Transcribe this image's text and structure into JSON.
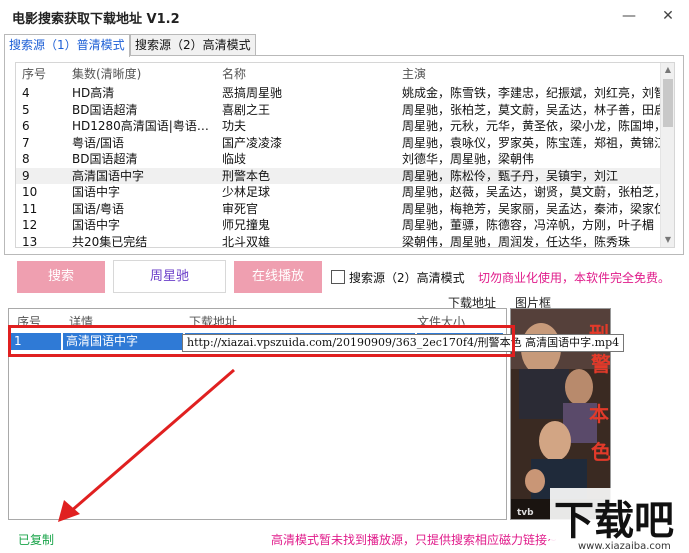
{
  "window": {
    "title": "电影搜索获取下载地址 V1.2",
    "minimize_glyph": "—",
    "close_glyph": "✕"
  },
  "tabs": [
    {
      "label": "搜索源（1）普清模式",
      "active": true
    },
    {
      "label": "搜索源（2）高清模式",
      "active": false
    }
  ],
  "movie_list": {
    "columns": [
      "序号",
      "集数(清晰度)",
      "名称",
      "主演"
    ],
    "rows": [
      {
        "no": "4",
        "episodes": "HD高清",
        "name": "恶搞周星驰",
        "actors": "姚成金，陈雪铁，李建忠，纪振斌，刘红亮，刘智远"
      },
      {
        "no": "5",
        "episodes": "BD国语超清",
        "name": "喜剧之王",
        "actors": "周星驰，张柏芝，莫文蔚，吴孟达，林子善，田启文…"
      },
      {
        "no": "6",
        "episodes": "HD1280高清国语|粤语…",
        "name": "功夫",
        "actors": "周星驰，元秋，元华，黄圣依，梁小龙，陈国坤，田…"
      },
      {
        "no": "7",
        "episodes": "粤语/国语",
        "name": "国产凌凌漆",
        "actors": "周星驰，袁咏仪，罗家英，陈宝莲，郑祖，黄锦江，…"
      },
      {
        "no": "8",
        "episodes": "BD国语超清",
        "name": "临歧",
        "actors": "刘德华，周星驰，梁朝伟"
      },
      {
        "no": "9",
        "episodes": "高清国语中字",
        "name": "刑警本色",
        "actors": "周星驰，陈松伶，甄子丹，吴镇宇，刘江"
      },
      {
        "no": "10",
        "episodes": "国语中字",
        "name": "少林足球",
        "actors": "周星驰，赵薇，吴孟达，谢贤，莫文蔚，张柏芝，黄…"
      },
      {
        "no": "11",
        "episodes": "国语/粤语",
        "name": "审死官",
        "actors": "周星驰，梅艳芳，吴家丽，吴孟达，秦沛，梁家仁，…"
      },
      {
        "no": "12",
        "episodes": "国语中字",
        "name": "师兄撞鬼",
        "actors": "周星驰，董骠，陈德容，冯淬帆，方刚，叶子楣"
      },
      {
        "no": "13",
        "episodes": "共20集已完结",
        "name": "北斗双雄",
        "actors": "梁朝伟，周星驰，周润发，任达华，陈秀珠"
      }
    ],
    "selected_row": 5
  },
  "controls": {
    "search_label": "搜索",
    "query_value": "周星驰",
    "play_label": "在线播放",
    "hd_checkbox_label": "搜索源（2）高清模式",
    "hd_checked": false,
    "notice": "切勿商业化使用，本软件完全免费。"
  },
  "download_section": {
    "label": "下载地址",
    "poster_label": "图片框",
    "columns": [
      "序号",
      "详情",
      "下载地址",
      "文件大小"
    ],
    "rows": [
      {
        "no": "1",
        "detail": "高清国语中字",
        "url": "http://xiazai.vpszuida.com/20190909/363_2ec170f4/刑警本色 高清国语中字.mp4",
        "size": ""
      }
    ],
    "tooltip": "http://xiazai.vpszuida.com/20190909/363_2ec170f4/刑警本色 高清国语中字.mp4"
  },
  "status": {
    "copied": "已复制",
    "message": "高清模式暂未找到播放源，只提供搜索相应磁力链接~"
  },
  "watermark": {
    "text": "下载吧",
    "url": "www.xiazaiba.com"
  },
  "poster": {
    "title_glyphs": "刑警本色",
    "tvb_glyph": "tvb"
  },
  "colors": {
    "tab_active": "#1d5fd6",
    "button_pink": "#ef9fb0",
    "notice": "#e01c8b",
    "copied": "#1aa44a",
    "selection": "#2f7ad6",
    "highlight_box": "#e02020"
  }
}
